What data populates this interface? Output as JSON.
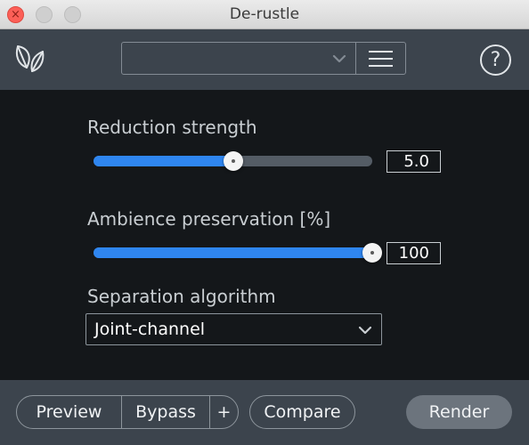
{
  "window": {
    "title": "De-rustle",
    "close_glyph": "×"
  },
  "header": {
    "preset_value": "",
    "help_label": "?"
  },
  "controls": {
    "reduction": {
      "label": "Reduction strength",
      "value": "5.0",
      "fraction": 0.5
    },
    "ambience": {
      "label": "Ambience preservation [%]",
      "value": "100",
      "fraction": 1.0
    },
    "algorithm": {
      "label": "Separation algorithm",
      "value": "Joint-channel"
    }
  },
  "footer": {
    "preview_label": "Preview",
    "bypass_label": "Bypass",
    "plus_label": "+",
    "compare_label": "Compare",
    "render_label": "Render"
  },
  "colors": {
    "accent": "#2f86f0",
    "panel": "#3c444d",
    "background": "#14171a"
  },
  "icons": {
    "app": "leaf-icon",
    "chevron": "chevron-down-icon",
    "menu": "hamburger-menu-icon",
    "help": "help-icon"
  }
}
